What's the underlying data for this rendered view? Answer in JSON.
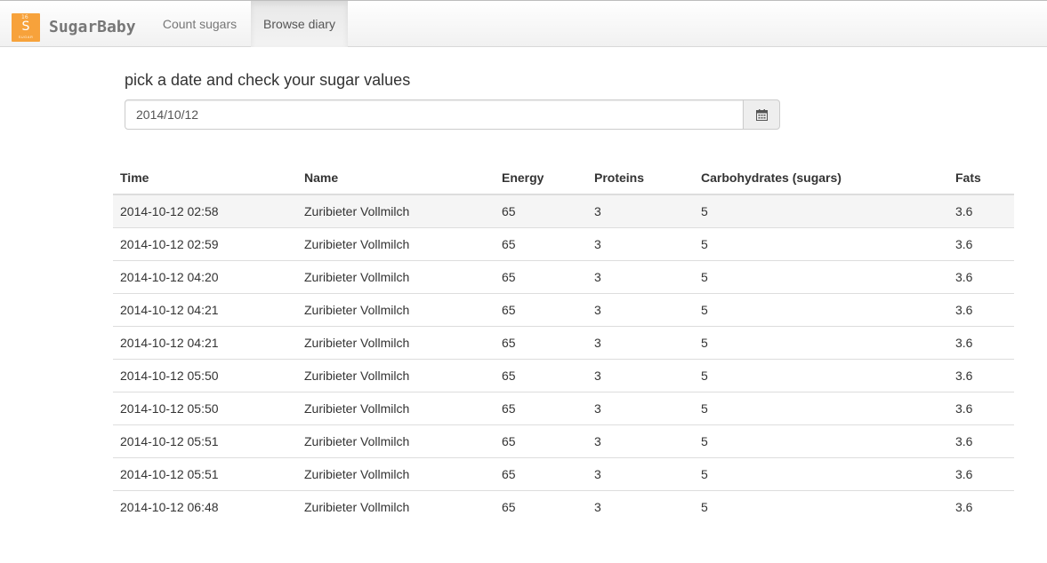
{
  "brand": {
    "logo": {
      "number": "16",
      "symbol": "S",
      "label": "SUGAR"
    },
    "name": "SugarBaby"
  },
  "nav": {
    "count_sugars": "Count sugars",
    "browse_diary": "Browse diary"
  },
  "page": {
    "heading": "pick a date and check your sugar values",
    "date_value": "2014/10/12",
    "calendar_icon": "calendar-icon"
  },
  "table": {
    "headers": [
      "Time",
      "Name",
      "Energy",
      "Proteins",
      "Carbohydrates (sugars)",
      "Fats"
    ],
    "rows": [
      [
        "2014-10-12 02:58",
        "Zuribieter Vollmilch",
        "65",
        "3",
        "5",
        "3.6"
      ],
      [
        "2014-10-12 02:59",
        "Zuribieter Vollmilch",
        "65",
        "3",
        "5",
        "3.6"
      ],
      [
        "2014-10-12 04:20",
        "Zuribieter Vollmilch",
        "65",
        "3",
        "5",
        "3.6"
      ],
      [
        "2014-10-12 04:21",
        "Zuribieter Vollmilch",
        "65",
        "3",
        "5",
        "3.6"
      ],
      [
        "2014-10-12 04:21",
        "Zuribieter Vollmilch",
        "65",
        "3",
        "5",
        "3.6"
      ],
      [
        "2014-10-12 05:50",
        "Zuribieter Vollmilch",
        "65",
        "3",
        "5",
        "3.6"
      ],
      [
        "2014-10-12 05:50",
        "Zuribieter Vollmilch",
        "65",
        "3",
        "5",
        "3.6"
      ],
      [
        "2014-10-12 05:51",
        "Zuribieter Vollmilch",
        "65",
        "3",
        "5",
        "3.6"
      ],
      [
        "2014-10-12 05:51",
        "Zuribieter Vollmilch",
        "65",
        "3",
        "5",
        "3.6"
      ],
      [
        "2014-10-12 06:48",
        "Zuribieter Vollmilch",
        "65",
        "3",
        "5",
        "3.6"
      ]
    ]
  },
  "colors": {
    "brand_logo": "#f7a23b",
    "nav_active_bg": "#e8e8e8"
  }
}
